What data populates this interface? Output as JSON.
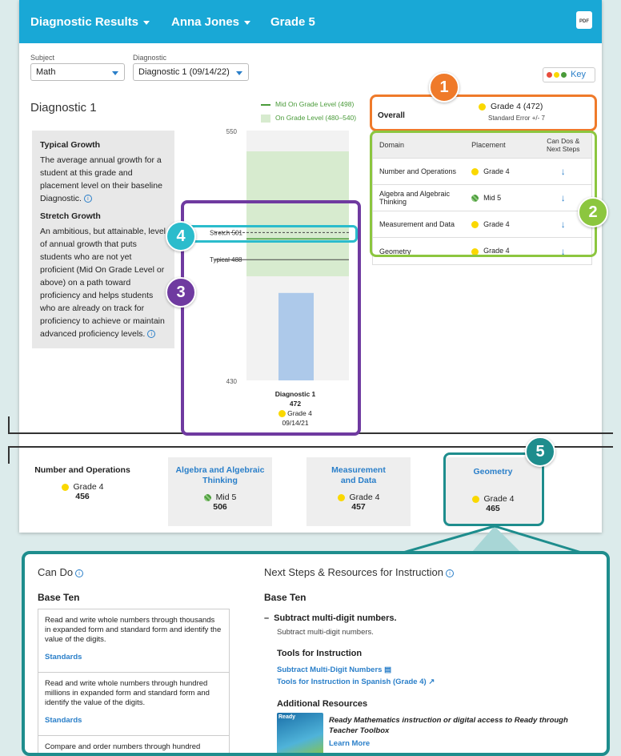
{
  "topbar": {
    "report": "Diagnostic Results",
    "student": "Anna Jones",
    "grade": "Grade 5",
    "pdf_icon": "PDF"
  },
  "filters": {
    "subject_label": "Subject",
    "subject_value": "Math",
    "diagnostic_label": "Diagnostic",
    "diagnostic_value": "Diagnostic 1 (09/14/22)",
    "key_label": "Key",
    "key_colors": [
      "#e84d3d",
      "#fad800",
      "#4a9b3a"
    ]
  },
  "diagnostic_title": "Diagnostic 1",
  "legend": {
    "mid": "Mid On Grade Level (498)",
    "on": "On Grade Level (480–540)"
  },
  "growth": {
    "typical_title": "Typical Growth",
    "typical_text": "The average annual growth for a student at this grade and placement level on their baseline Diagnostic.",
    "stretch_title": "Stretch Growth",
    "stretch_text": "An ambitious, but attainable, level of annual growth that puts students who are not yet proficient (Mid On Grade Level or above) on a path toward proficiency and helps students who are already on track for proficiency to achieve or maintain advanced proficiency levels."
  },
  "chart_data": {
    "type": "bar",
    "categories": [
      "Diagnostic 1"
    ],
    "values": [
      472
    ],
    "ylim": [
      430,
      550
    ],
    "y_ticks": [
      "550",
      "430"
    ],
    "on_grade_band": [
      480,
      540
    ],
    "mid_on_grade": 498,
    "stretch": {
      "label": "Stretch 501",
      "value": 501
    },
    "typical": {
      "label": "Typical 488",
      "value": 488
    },
    "bar_info": {
      "name": "Diagnostic 1",
      "score": "472",
      "placement": "Grade 4",
      "date": "09/14/21"
    },
    "colors": {
      "bar": "#adc9ea",
      "band": "#d7ebcf",
      "mid": "#4a9b3a"
    }
  },
  "overall": {
    "label": "Overall",
    "placement": "Grade 4 (472)",
    "stderr": "Standard Error +/- 7"
  },
  "domain_table": {
    "headers": [
      "Domain",
      "Placement",
      "Can Dos & Next Steps"
    ],
    "rows": [
      {
        "domain": "Number and Operations",
        "placement": "Grade 4",
        "status": "yellow"
      },
      {
        "domain": "Algebra and Algebraic Thinking",
        "placement": "Mid 5",
        "status": "green"
      },
      {
        "domain": "Measurement and Data",
        "placement": "Grade 4",
        "status": "yellow"
      },
      {
        "domain": "Geometry",
        "placement": "Grade 4",
        "status": "yellow"
      }
    ],
    "arrow": "↓"
  },
  "callouts": [
    "1",
    "2",
    "3",
    "4",
    "5"
  ],
  "domain_cards": [
    {
      "title": "Number and Operations",
      "placement": "Grade 4",
      "score": "456"
    },
    {
      "title": "Algebra and Algebraic Thinking",
      "placement": "Mid 5",
      "score": "506"
    },
    {
      "title": "Measurement and Data",
      "placement": "Grade 4",
      "score": "457"
    },
    {
      "title": "Geometry",
      "placement": "Grade 4",
      "score": "465"
    }
  ],
  "detail": {
    "can_do_title": "Can Do",
    "can_do_section": "Base Ten",
    "can_do_items": [
      {
        "text": "Read and write whole numbers through thousands in expanded form and standard form and identify the value of the digits.",
        "link": "Standards"
      },
      {
        "text": "Read and write whole numbers through hundred millions in expanded form and standard form and identify the value of the digits.",
        "link": "Standards"
      },
      {
        "text": "Compare and order numbers through hundred",
        "link": ""
      }
    ],
    "next_title": "Next Steps & Resources for Instruction",
    "next_section": "Base Ten",
    "skill_title": "Subtract multi-digit numbers.",
    "skill_text": "Subtract multi-digit numbers.",
    "tools_title": "Tools for Instruction",
    "tools_links": [
      "Subtract Multi-Digit Numbers",
      "Tools for Instruction in Spanish (Grade 4)"
    ],
    "additional_title": "Additional Resources",
    "resource_text": "Ready Mathematics instruction or digital access to Ready through Teacher Toolbox",
    "resource_link": "Learn More",
    "book_label": "Ready"
  }
}
